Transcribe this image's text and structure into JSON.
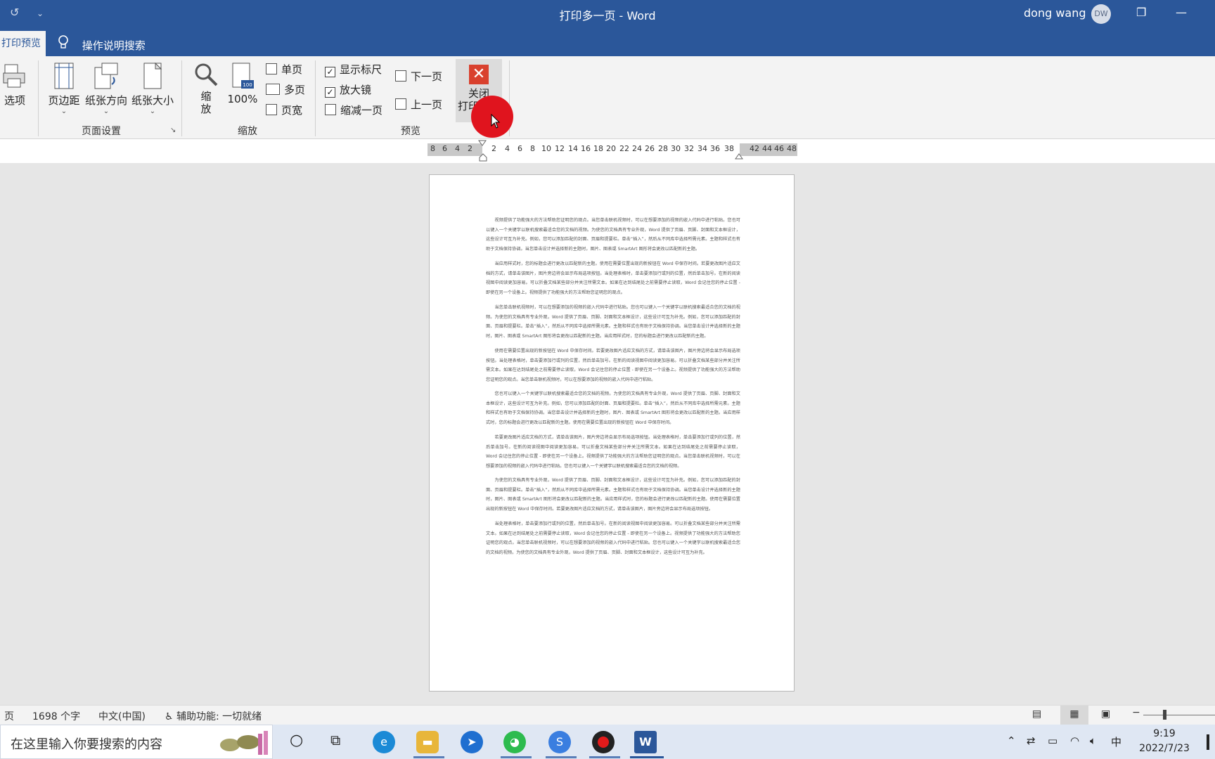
{
  "window": {
    "title": "打印多一页 - Word",
    "user_name": "dong wang",
    "user_initials": "DW",
    "qa_undo": "↺",
    "qa_customize": "⌄",
    "restore_glyph": "❐",
    "minimize_glyph": "—"
  },
  "ribbon": {
    "active_tab": "打印预览",
    "tell_me": "操作说明搜索",
    "options_label": "选项",
    "margins_label": "页边距",
    "orientation_label": "纸张方向",
    "size_label": "纸张大小",
    "page_setup_group": "页面设置",
    "zoom_label": "缩\n放",
    "zoom_100_label": "100%",
    "zoom_group": "缩放",
    "one_page": "单页",
    "multi_page": "多页",
    "page_width": "页宽",
    "show_ruler": "显示标尺",
    "magnifier": "放大镜",
    "shrink_one_page": "缩减一页",
    "next_page": "下一页",
    "prev_page": "上一页",
    "preview_group": "预览",
    "close_line1": "关闭",
    "close_line2": "打印预览",
    "close_icon": "✕",
    "show_ruler_checked": true,
    "magnifier_checked": true
  },
  "ruler": {
    "ticks": [
      "8",
      "6",
      "4",
      "2",
      "2",
      "4",
      "6",
      "8",
      "10",
      "12",
      "14",
      "16",
      "18",
      "20",
      "22",
      "24",
      "26",
      "28",
      "30",
      "32",
      "34",
      "36",
      "38",
      "42",
      "44",
      "46",
      "48"
    ]
  },
  "document": {
    "paragraphs": [
      "　　视频提供了功能强大的方法帮助您证明您的观点。当您单击联机视频时，可以在想要添加的视频的嵌入代码中进行粘贴。您也可以键入一个关键字以联机搜索最适合您的文档的视频。为使您的文档具有专业外观，Word 提供了页眉、页脚、封面和文本框设计，这些设计可互为补充。例如，您可以添加匹配的封面、页眉和提要栏。单击“插入”，然后从不同库中选择所需元素。主题和样式也有助于文档保持协调。当您单击设计并选择新的主题时，图片、图表或 SmartArt 图形将会更改以匹配新的主题。",
      "　　当应用样式时，您的标题会进行更改以匹配新的主题。使用在需要位置出现的新按钮在 Word 中保存时间。若要更改图片适应文档的方式，请单击该图片，图片旁边将会显示布局选项按钮。当处理表格时，单击要添加行或列的位置，然后单击加号。在新的阅读视图中阅读更加容易。可以折叠文档某些部分并关注所需文本。如果在达到结尾处之前需要停止读取，Word 会记住您的停止位置 - 即使在另一个设备上。视频提供了功能强大的方法帮助您证明您的观点。",
      "　　当您单击联机视频时，可以在想要添加的视频的嵌入代码中进行粘贴。您也可以键入一个关键字以联机搜索最适合您的文档的视频。为使您的文档具有专业外观，Word 提供了页眉、页脚、封面和文本框设计，这些设计可互为补充。例如，您可以添加匹配的封面、页眉和提要栏。单击“插入”，然后从不同库中选择所需元素。主题和样式也有助于文档保持协调。当您单击设计并选择新的主题时，图片、图表或 SmartArt 图形将会更改以匹配新的主题。当应用样式时，您的标题会进行更改以匹配新的主题。",
      "　　使用在需要位置出现的新按钮在 Word 中保存时间。若要更改图片适应文档的方式，请单击该图片，图片旁边将会显示布局选项按钮。当处理表格时，单击要添加行或列的位置，然后单击加号。在新的阅读视图中阅读更加容易。可以折叠文档某些部分并关注所需文本。如果在达到结尾处之前需要停止读取，Word 会记住您的停止位置 - 即使在另一个设备上。视频提供了功能强大的方法帮助您证明您的观点。当您单击联机视频时，可以在想要添加的视频的嵌入代码中进行粘贴。",
      "　　您也可以键入一个关键字以联机搜索最适合您的文档的视频。为使您的文档具有专业外观，Word 提供了页眉、页脚、封面和文本框设计，这些设计可互为补充。例如，您可以添加匹配的封面、页眉和提要栏。单击“插入”，然后从不同库中选择所需元素。主题和样式也有助于文档保持协调。当您单击设计并选择新的主题时，图片、图表或 SmartArt 图形将会更改以匹配新的主题。当应用样式时，您的标题会进行更改以匹配新的主题。使用在需要位置出现的新按钮在 Word 中保存时间。",
      "　　若要更改图片适应文档的方式，请单击该图片，图片旁边将会显示布局选项按钮。当处理表格时，单击要添加行或列的位置，然后单击加号。在新的阅读视图中阅读更加容易。可以折叠文档某些部分并关注所需文本。如果在达到结尾处之前需要停止读取，Word 会记住您的停止位置 - 即使在另一个设备上。视频提供了功能强大的方法帮助您证明您的观点。当您单击联机视频时，可以在想要添加的视频的嵌入代码中进行粘贴。您也可以键入一个关键字以联机搜索最适合您的文档的视频。",
      "　　为使您的文档具有专业外观，Word 提供了页眉、页脚、封面和文本框设计，这些设计可互为补充。例如，您可以添加匹配的封面、页眉和提要栏。单击“插入”，然后从不同库中选择所需元素。主题和样式也有助于文档保持协调。当您单击设计并选择新的主题时，图片、图表或 SmartArt 图形将会更改以匹配新的主题。当应用样式时，您的标题会进行更改以匹配新的主题。使用在需要位置出现的新按钮在 Word 中保存时间。若要更改图片适应文档的方式，请单击该图片，图片旁边将会显示布局选项按钮。",
      "　　当处理表格时，单击要添加行或列的位置，然后单击加号。在新的阅读视图中阅读更加容易。可以折叠文档某些部分并关注所需文本。如果在达到结尾处之前需要停止读取，Word 会记住您的停止位置 - 即使在另一个设备上。视频提供了功能强大的方法帮助您证明您的观点。当您单击联机视频时，可以在想要添加的视频的嵌入代码中进行粘贴。您也可以键入一个关键字以联机搜索最适合您的文档的视频。为使您的文档具有专业外观，Word 提供了页眉、页脚、封面和文本框设计，这些设计可互为补充。"
    ]
  },
  "statusbar": {
    "page": "页",
    "word_count": "1698 个字",
    "language": "中文(中国)",
    "accessibility": "辅助功能: 一切就绪"
  },
  "taskbar": {
    "search_placeholder": "在这里输入你要搜索的内容",
    "ime": "中",
    "time": "9:19",
    "date": "2022/7/23"
  },
  "colors": {
    "word_blue": "#2b579a",
    "close_red": "#d9412e",
    "click_indicator": "#e0141e"
  }
}
